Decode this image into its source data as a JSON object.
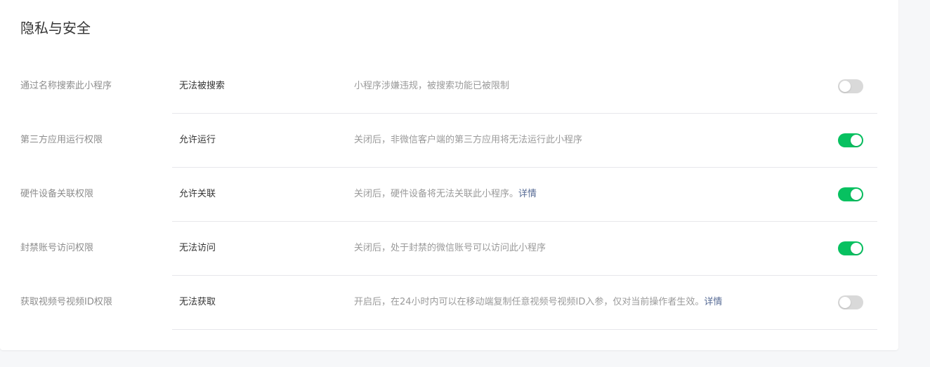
{
  "section": {
    "title": "隐私与安全"
  },
  "settings": [
    {
      "label": "通过名称搜索此小程序",
      "value": "无法被搜索",
      "description": "小程序涉嫌违规，被搜索功能已被限制",
      "link": "",
      "enabled": false
    },
    {
      "label": "第三方应用运行权限",
      "value": "允许运行",
      "description": "关闭后，非微信客户端的第三方应用将无法运行此小程序",
      "link": "",
      "enabled": true
    },
    {
      "label": "硬件设备关联权限",
      "value": "允许关联",
      "description": "关闭后，硬件设备将无法关联此小程序。",
      "link": "详情",
      "enabled": true
    },
    {
      "label": "封禁账号访问权限",
      "value": "无法访问",
      "description": "关闭后，处于封禁的微信账号可以访问此小程序",
      "link": "",
      "enabled": true
    },
    {
      "label": "获取视频号视频ID权限",
      "value": "无法获取",
      "description": "开启后，在24小时内可以在移动端复制任意视频号视频ID入参，仅对当前操作者生效。",
      "link": "详情",
      "enabled": false
    }
  ],
  "colors": {
    "toggle_on": "#07c160",
    "toggle_off": "#d9d9d9",
    "link": "#576b95"
  }
}
